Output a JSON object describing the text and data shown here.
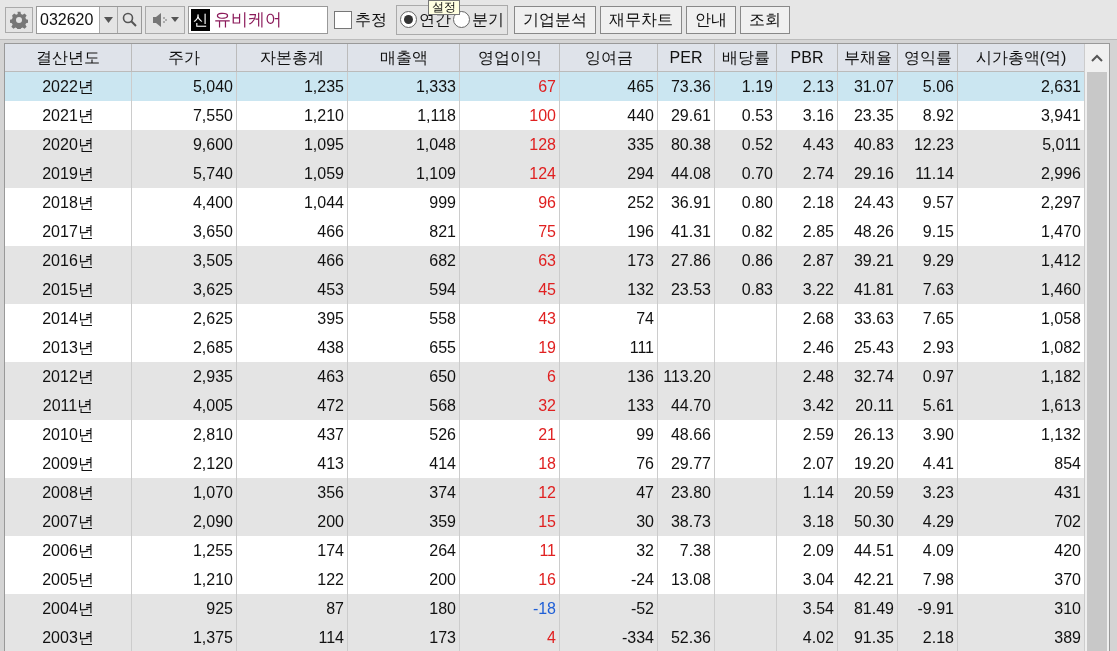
{
  "toolbar": {
    "code": "032620",
    "market_badge": "신",
    "company": "유비케어",
    "estimate": {
      "label": "추정",
      "checked": false
    },
    "period": [
      {
        "label": "연간",
        "selected": true
      },
      {
        "label": "분기",
        "selected": false
      }
    ],
    "buttons": [
      "기업분석",
      "재무차트",
      "안내",
      "조회"
    ],
    "tooltip": "설정"
  },
  "table": {
    "columns": [
      "결산년도",
      "주가",
      "자본총계",
      "매출액",
      "영업이익",
      "잉여금",
      "PER",
      "배당률",
      "PBR",
      "부채율",
      "영익률",
      "시가총액(억)"
    ],
    "rows": [
      {
        "selected": true,
        "loss": false,
        "cells": [
          "2022년",
          "5,040",
          "1,235",
          "1,333",
          "67",
          "465",
          "73.36",
          "1.19",
          "2.13",
          "31.07",
          "5.06",
          "2,631"
        ]
      },
      {
        "selected": false,
        "loss": false,
        "cells": [
          "2021년",
          "7,550",
          "1,210",
          "1,118",
          "100",
          "440",
          "29.61",
          "0.53",
          "3.16",
          "23.35",
          "8.92",
          "3,941"
        ]
      },
      {
        "selected": false,
        "loss": false,
        "cells": [
          "2020년",
          "9,600",
          "1,095",
          "1,048",
          "128",
          "335",
          "80.38",
          "0.52",
          "4.43",
          "40.83",
          "12.23",
          "5,011"
        ]
      },
      {
        "selected": false,
        "loss": false,
        "cells": [
          "2019년",
          "5,740",
          "1,059",
          "1,109",
          "124",
          "294",
          "44.08",
          "0.70",
          "2.74",
          "29.16",
          "11.14",
          "2,996"
        ]
      },
      {
        "selected": false,
        "loss": false,
        "cells": [
          "2018년",
          "4,400",
          "1,044",
          "999",
          "96",
          "252",
          "36.91",
          "0.80",
          "2.18",
          "24.43",
          "9.57",
          "2,297"
        ]
      },
      {
        "selected": false,
        "loss": false,
        "cells": [
          "2017년",
          "3,650",
          "466",
          "821",
          "75",
          "196",
          "41.31",
          "0.82",
          "2.85",
          "48.26",
          "9.15",
          "1,470"
        ]
      },
      {
        "selected": false,
        "loss": false,
        "cells": [
          "2016년",
          "3,505",
          "466",
          "682",
          "63",
          "173",
          "27.86",
          "0.86",
          "2.87",
          "39.21",
          "9.29",
          "1,412"
        ]
      },
      {
        "selected": false,
        "loss": false,
        "cells": [
          "2015년",
          "3,625",
          "453",
          "594",
          "45",
          "132",
          "23.53",
          "0.83",
          "3.22",
          "41.81",
          "7.63",
          "1,460"
        ]
      },
      {
        "selected": false,
        "loss": false,
        "cells": [
          "2014년",
          "2,625",
          "395",
          "558",
          "43",
          "74",
          "",
          "",
          "2.68",
          "33.63",
          "7.65",
          "1,058"
        ]
      },
      {
        "selected": false,
        "loss": false,
        "cells": [
          "2013년",
          "2,685",
          "438",
          "655",
          "19",
          "111",
          "",
          "",
          "2.46",
          "25.43",
          "2.93",
          "1,082"
        ]
      },
      {
        "selected": false,
        "loss": false,
        "cells": [
          "2012년",
          "2,935",
          "463",
          "650",
          "6",
          "136",
          "113.20",
          "",
          "2.48",
          "32.74",
          "0.97",
          "1,182"
        ]
      },
      {
        "selected": false,
        "loss": false,
        "cells": [
          "2011년",
          "4,005",
          "472",
          "568",
          "32",
          "133",
          "44.70",
          "",
          "3.42",
          "20.11",
          "5.61",
          "1,613"
        ]
      },
      {
        "selected": false,
        "loss": false,
        "cells": [
          "2010년",
          "2,810",
          "437",
          "526",
          "21",
          "99",
          "48.66",
          "",
          "2.59",
          "26.13",
          "3.90",
          "1,132"
        ]
      },
      {
        "selected": false,
        "loss": false,
        "cells": [
          "2009년",
          "2,120",
          "413",
          "414",
          "18",
          "76",
          "29.77",
          "",
          "2.07",
          "19.20",
          "4.41",
          "854"
        ]
      },
      {
        "selected": false,
        "loss": false,
        "cells": [
          "2008년",
          "1,070",
          "356",
          "374",
          "12",
          "47",
          "23.80",
          "",
          "1.14",
          "20.59",
          "3.23",
          "431"
        ]
      },
      {
        "selected": false,
        "loss": false,
        "cells": [
          "2007년",
          "2,090",
          "200",
          "359",
          "15",
          "30",
          "38.73",
          "",
          "3.18",
          "50.30",
          "4.29",
          "702"
        ]
      },
      {
        "selected": false,
        "loss": false,
        "cells": [
          "2006년",
          "1,255",
          "174",
          "264",
          "11",
          "32",
          "7.38",
          "",
          "2.09",
          "44.51",
          "4.09",
          "420"
        ]
      },
      {
        "selected": false,
        "loss": false,
        "cells": [
          "2005년",
          "1,210",
          "122",
          "200",
          "16",
          "-24",
          "13.08",
          "",
          "3.04",
          "42.21",
          "7.98",
          "370"
        ]
      },
      {
        "selected": false,
        "loss": true,
        "cells": [
          "2004년",
          "925",
          "87",
          "180",
          "-18",
          "-52",
          "",
          "",
          "3.54",
          "81.49",
          "-9.91",
          "310"
        ]
      },
      {
        "selected": false,
        "loss": false,
        "cells": [
          "2003년",
          "1,375",
          "114",
          "173",
          "4",
          "-334",
          "52.36",
          "",
          "4.02",
          "91.35",
          "2.18",
          "389"
        ]
      }
    ]
  }
}
